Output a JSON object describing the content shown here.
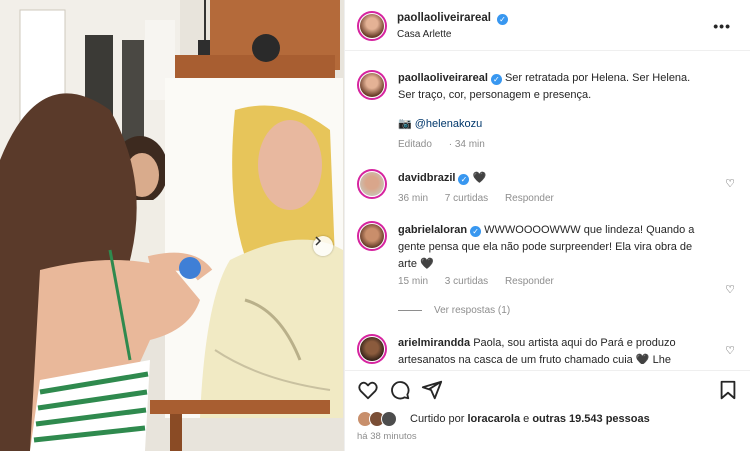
{
  "post": {
    "author": "paollaoliveirareal",
    "location": "Casa Arlette"
  },
  "caption": {
    "author": "paollaoliveirareal",
    "text": "Ser retratada por Helena. Ser Helena. Ser traço, cor, personagem e presença.",
    "credit_icon": "📷",
    "credit_mention": "@helenakozu",
    "edited": "Editado",
    "age": "34 min"
  },
  "comments": [
    {
      "user": "davidbrazil",
      "verified": true,
      "text": "🖤",
      "age": "36 min",
      "likes": "7 curtidas",
      "reply": "Responder"
    },
    {
      "user": "gabrielaloran",
      "verified": true,
      "text": "WWWOOOOWWW que lindeza! Quando a gente pensa que ela não pode surpreender! Ela vira obra de arte 🖤",
      "age": "15 min",
      "likes": "3 curtidas",
      "reply": "Responder",
      "view_replies": "Ver respostas (1)"
    },
    {
      "user": "ariel­mirandda",
      "verified": false,
      "text": "Paola, sou artista aqui do Pará e produzo artesanatos na casca de um fruto chamado cuia 🖤 Lhe convido"
    }
  ],
  "likes": {
    "prefix": "Curtido por",
    "user": "loracarola",
    "connector": "e",
    "count": "outras 19.543 pessoas"
  },
  "time_ago": "há 38 minutos",
  "colors": {
    "verified": "#3897f0",
    "ring": "#d6249f",
    "link": "#00376b",
    "muted": "#8e8e8e"
  }
}
